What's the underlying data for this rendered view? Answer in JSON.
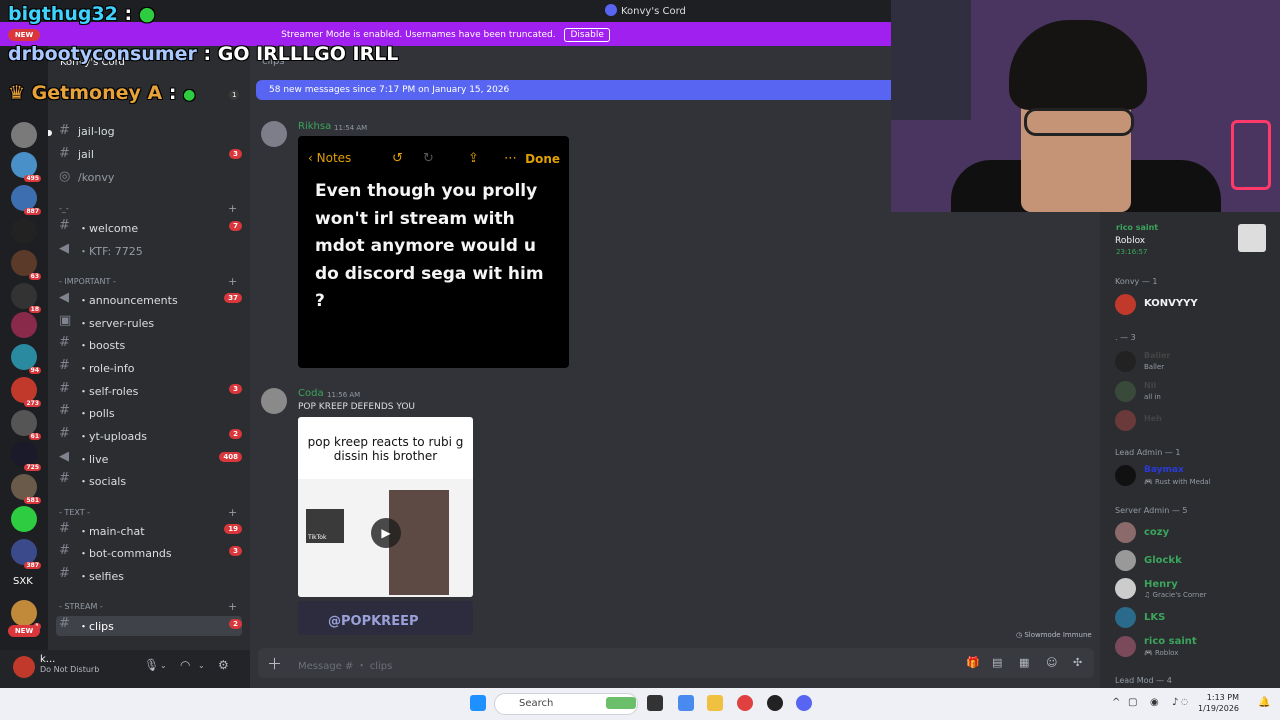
{
  "window": {
    "title": "Konvy's Cord"
  },
  "streamer_banner": {
    "text": "Streamer Mode is enabled. Usernames have been truncated.",
    "button": "Disable"
  },
  "server": {
    "name": "Konvy's Cord",
    "channel_header": "clips"
  },
  "server_rail": {
    "new_label": "NEW",
    "badges": [
      "495",
      "887",
      "63",
      "18",
      "94",
      "273",
      "61",
      "725",
      "581",
      "387",
      "1"
    ],
    "sxk": "SXK"
  },
  "channels": {
    "jail_log": "jail-log",
    "jail": "jail",
    "jail_count": "3",
    "konvy": "/konvy",
    "cat_misc": "-_- ",
    "welcome": "・welcome",
    "welcome_count": "7",
    "ktf": "・KTF: 7725",
    "cat_important": "- IMPORTANT -",
    "announcements": "・announcements",
    "announcements_count": "37",
    "server_rules": "・server-rules",
    "boosts": "・boosts",
    "role_info": "・role-info",
    "self_roles": "・self-roles",
    "self_roles_count": "3",
    "polls": "・polls",
    "yt_uploads": "・yt-uploads",
    "yt_uploads_count": "2",
    "live": "・live",
    "live_count": "408",
    "socials": "・socials",
    "cat_text": "- TEXT -",
    "main_chat": "・main-chat",
    "main_chat_count": "19",
    "bot_commands": "・bot-commands",
    "bot_commands_count": "3",
    "selfies": "・selfies",
    "cat_stream": "- STREAM -",
    "clips": "・clips",
    "clips_count": "2"
  },
  "user_panel": {
    "name": "k...",
    "status": "Do Not Disturb"
  },
  "new_messages_bar": "58 new messages since 7:17 PM on January 15, 2026",
  "messages": [
    {
      "author": "Rikhsa",
      "time": "11:54 AM",
      "color": "#3ba55c"
    },
    {
      "author": "Coda",
      "time": "11:56 AM",
      "text": "POP KREEP DEFENDS YOU",
      "color": "#3ba55c"
    }
  ],
  "notes_screenshot": {
    "back": "Notes",
    "done": "Done",
    "body": "Even though you prolly won't irl stream with mdot anymore would u do discord sega wit him ?"
  },
  "video_embed": {
    "caption": "pop kreep reacts to rubi g dissin his brother",
    "watermark": "@POPKREEP",
    "tiktok_label": "TikTok"
  },
  "composer": {
    "placeholder": "Message # ・ clips",
    "slowmode": "Slowmode Immune"
  },
  "members": {
    "activity_card": {
      "name": "rico saint",
      "game": "Roblox",
      "elapsed": "23:16:57"
    },
    "groups": [
      {
        "label": "Konvy — 1"
      },
      {
        "label": ". — 3"
      },
      {
        "label": "Lead Admin — 1"
      },
      {
        "label": "Server Admin — 5"
      },
      {
        "label": "Lead Mod — 4"
      }
    ],
    "konvy": "KONVYYY",
    "dot_members": [
      {
        "name": "Baller",
        "sub": "Baller"
      },
      {
        "name": "Nil",
        "sub": "all in"
      },
      {
        "name": "Heh",
        "sub": ""
      }
    ],
    "lead_admin": {
      "name": "Baymax",
      "sub": "Rust with Medal"
    },
    "server_admins": [
      {
        "name": "cozy",
        "sub": ""
      },
      {
        "name": "Glockk",
        "sub": ""
      },
      {
        "name": "Henry",
        "sub": "Gracie's Corner"
      },
      {
        "name": "LKS",
        "sub": ""
      },
      {
        "name": "rico saint",
        "sub": "Roblox"
      }
    ]
  },
  "stream_overlay": {
    "line1_user": "bigthug32",
    "line2_user": "drbootyconsumer",
    "line2_text": "GO IRLLLGO IRLL",
    "line3_user": "Getmoney A",
    "line3_count": "1"
  },
  "taskbar": {
    "search": "Search",
    "time": "1:13 PM",
    "date": "1/19/2026"
  },
  "colors": {
    "accent": "#5865f2",
    "banner": "#a020f0",
    "mention": "#da373c",
    "green": "#3ba55c"
  }
}
